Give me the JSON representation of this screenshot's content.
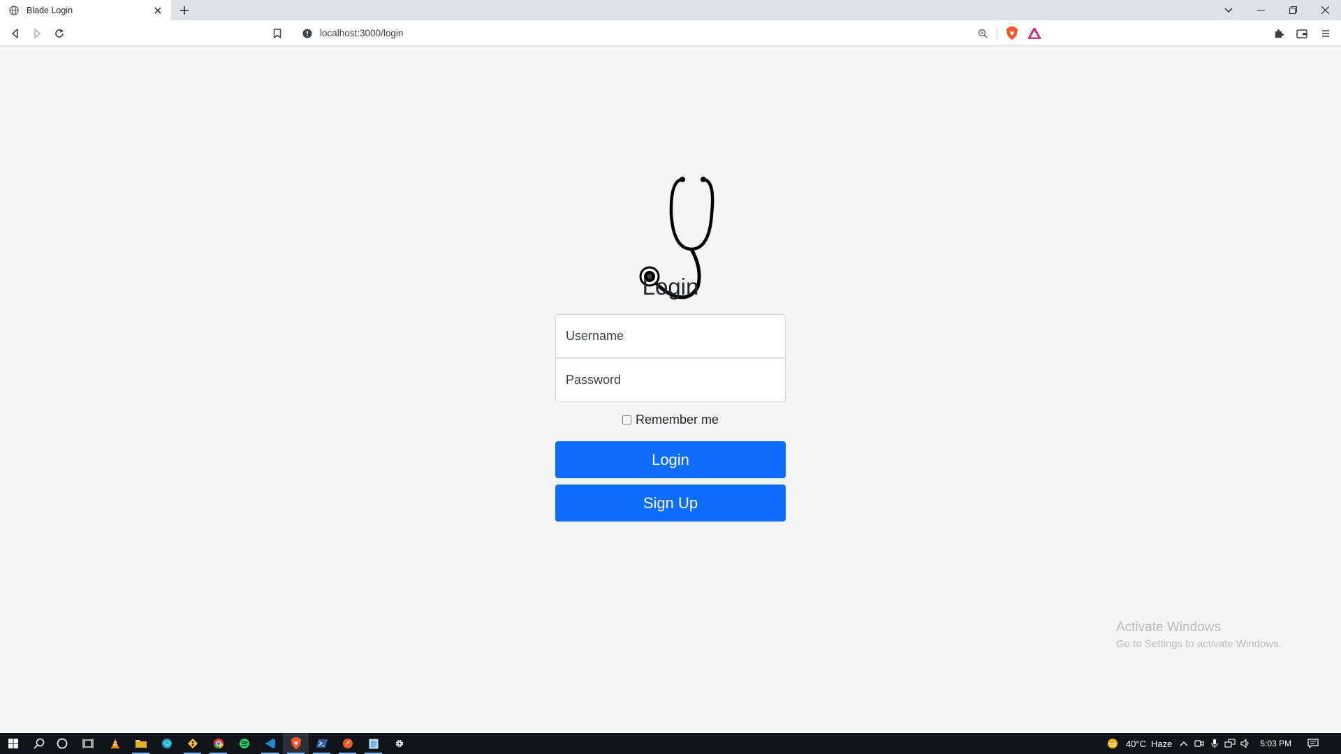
{
  "browser": {
    "tab_title": "Blade Login",
    "url": "localhost:3000/login"
  },
  "page": {
    "logo_icon": "stethoscope-icon",
    "heading": "Login",
    "username_placeholder": "Username",
    "password_placeholder": "Password",
    "remember_label": "Remember me",
    "login_button": "Login",
    "signup_button": "Sign Up",
    "accent_color": "#0d6efd"
  },
  "watermark": {
    "line1": "Activate Windows",
    "line2": "Go to Settings to activate Windows."
  },
  "taskbar": {
    "weather_temp": "40°C",
    "weather_desc": "Haze",
    "time": "5:03 PM",
    "apps": [
      "start",
      "search",
      "cortana",
      "task-view",
      "vlc",
      "file-explorer",
      "edge",
      "git",
      "chrome",
      "spotify",
      "vscode",
      "brave",
      "powershell",
      "postman",
      "notepad",
      "settings"
    ]
  }
}
